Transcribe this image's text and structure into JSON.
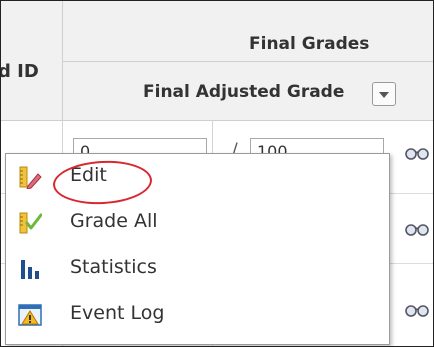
{
  "table": {
    "id_header_fragment": "d ID",
    "group_header": "Final Grades",
    "column_header": "Final Adjusted Grade",
    "column_menu_icon": "dropdown-arrow-icon",
    "rows": [
      {
        "grade_value": "0",
        "denominator_value": "100",
        "action_icon": "glasses-icon"
      },
      {
        "grade_value": "",
        "denominator_value": "",
        "action_icon": "glasses-icon"
      },
      {
        "grade_value": "",
        "denominator_value": "",
        "action_icon": "glasses-icon"
      }
    ],
    "separator": "/"
  },
  "context_menu": {
    "items": [
      {
        "label": "Edit",
        "icon": "pencil-ruler-icon"
      },
      {
        "label": "Grade All",
        "icon": "checkmark-ruler-icon"
      },
      {
        "label": "Statistics",
        "icon": "bar-chart-icon"
      },
      {
        "label": "Event Log",
        "icon": "warning-window-icon"
      }
    ]
  },
  "colors": {
    "highlight_circle": "#d8282f",
    "header_background": "#f1f1f1"
  }
}
